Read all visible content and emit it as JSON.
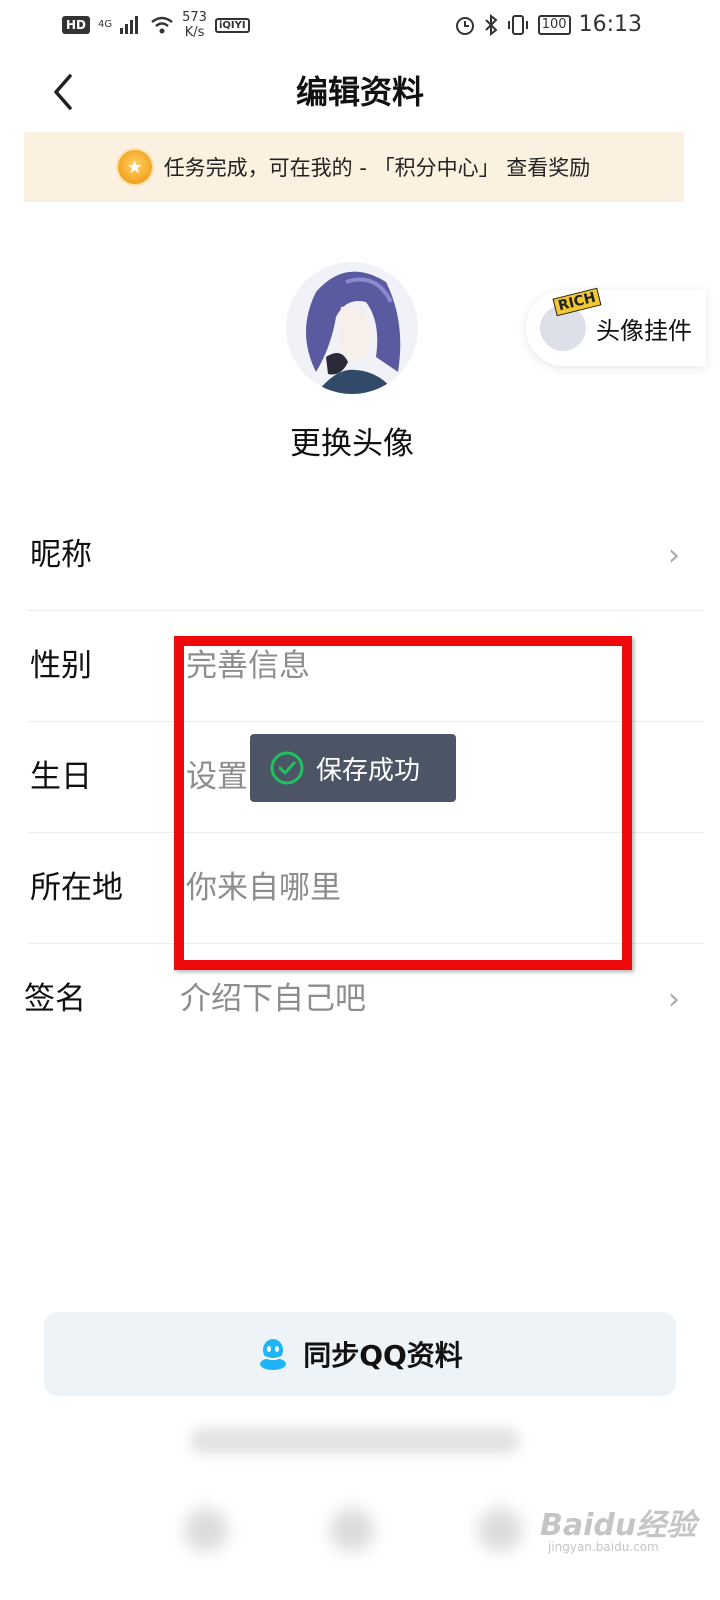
{
  "status_bar": {
    "hd": "HD",
    "network": "4G",
    "speed_value": "573",
    "speed_unit": "K/s",
    "app_badge": "iQIYI",
    "battery": "100",
    "time": "16:13"
  },
  "nav": {
    "title": "编辑资料"
  },
  "banner": {
    "text": "任务完成，可在我的 - 「积分中心」 查看奖励"
  },
  "avatar": {
    "change_label": "更换头像",
    "pendant_badge": "RICH",
    "pendant_label": "头像挂件"
  },
  "form": {
    "rows": [
      {
        "label": "昵称",
        "value": "",
        "chevron": "›"
      },
      {
        "label": "性别",
        "value": "完善信息",
        "chevron": ""
      },
      {
        "label": "生日",
        "value": "设置",
        "chevron": ""
      },
      {
        "label": "所在地",
        "value": "你来自哪里",
        "chevron": ""
      },
      {
        "label": "签名",
        "value": "介绍下自己吧",
        "chevron": "›"
      }
    ]
  },
  "toast": {
    "text": "保存成功"
  },
  "sync_button": {
    "label": "同步QQ资料"
  },
  "watermark": {
    "text": "Baidu经验",
    "sub": "jingyan.baidu.com"
  },
  "colors": {
    "highlight": "#ee0a0a",
    "toast_bg": "#4b5565",
    "success": "#21c25d",
    "banner_bg": "#fbf1e0",
    "qq_blue": "#1fb4f5"
  }
}
